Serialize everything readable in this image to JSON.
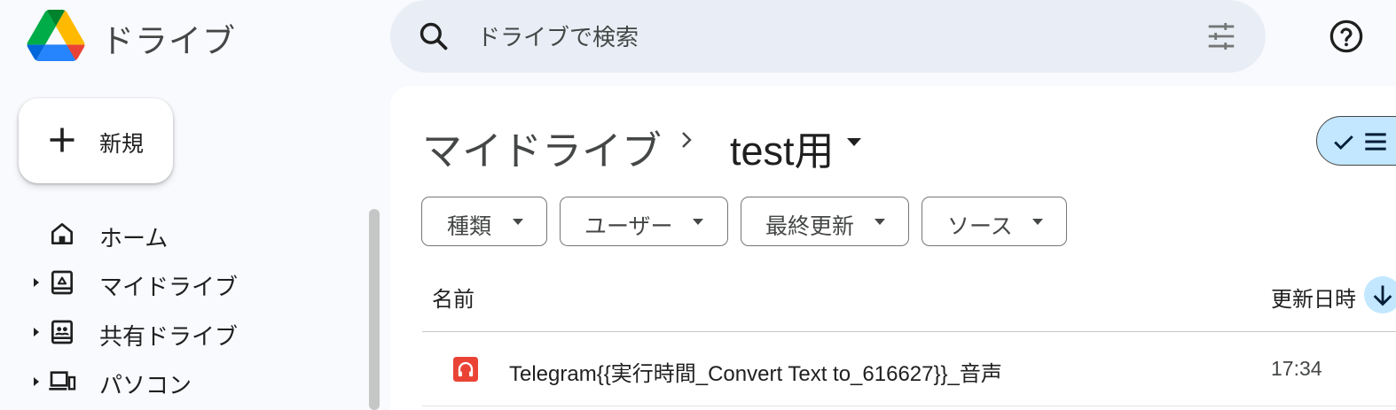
{
  "header": {
    "app_title": "ドライブ",
    "search": {
      "placeholder": "ドライブで検索",
      "value": ""
    },
    "icons": [
      "drive-logo",
      "search-icon",
      "tune-icon",
      "help-icon"
    ]
  },
  "sidebar": {
    "new_button": {
      "label": "新規"
    },
    "items": [
      {
        "label": "ホーム",
        "icon": "home-icon",
        "expandable": false
      },
      {
        "label": "マイドライブ",
        "icon": "my-drive-icon",
        "expandable": true
      },
      {
        "label": "共有ドライブ",
        "icon": "shared-drives-icon",
        "expandable": true
      },
      {
        "label": "パソコン",
        "icon": "computers-icon",
        "expandable": true
      }
    ]
  },
  "main": {
    "breadcrumb": {
      "root": "マイドライブ",
      "current": "test用"
    },
    "filters": [
      {
        "label": "種類"
      },
      {
        "label": "ユーザー"
      },
      {
        "label": "最終更新"
      },
      {
        "label": "ソース"
      }
    ],
    "table": {
      "columns": [
        "名前",
        "更新日時"
      ],
      "sort": "descending",
      "rows": [
        {
          "name": "Telegram{{実行時間_Convert Text to_616627}}_音声",
          "modified": "17:34",
          "type_icon": "audio-file-icon"
        }
      ]
    }
  },
  "colors": {
    "background": "#f8fafd",
    "search_bg": "#e9eef6",
    "accent_light": "#c2e7ff",
    "audio_file": "#ea4335"
  }
}
